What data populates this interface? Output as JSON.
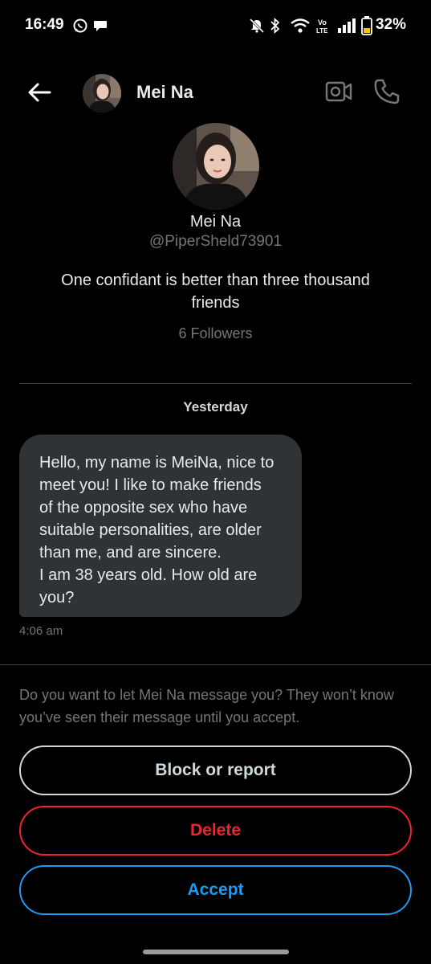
{
  "status_bar": {
    "time": "16:49",
    "battery": "32%",
    "icons": [
      "whatsapp-icon",
      "chat-bubble-icon",
      "silent-bell-icon",
      "bluetooth-icon",
      "wifi-icon",
      "volte-icon",
      "signal-icon",
      "battery-icon"
    ]
  },
  "header": {
    "name": "Mei Na",
    "icons": [
      "back-arrow-icon",
      "video-call-icon",
      "phone-icon"
    ]
  },
  "profile": {
    "name": "Mei Na",
    "handle": "@PiperSheld73901",
    "bio": "One confidant is better than three thousand friends",
    "followers": "6 Followers"
  },
  "conversation": {
    "day_label": "Yesterday",
    "messages": [
      {
        "lines": [
          "Hello, my name is MeiNa, nice to",
          "meet you! I like to make friends",
          "of the opposite sex who have",
          "suitable personalities, are older",
          "than me, and are sincere.",
          "I am 38 years old. How old are",
          "you?"
        ],
        "time": "4:06 am"
      }
    ]
  },
  "request": {
    "prompt": "Do you want to let Mei Na message you? They won’t know you’ve seen their message until you accept.",
    "block_label": "Block or report",
    "delete_label": "Delete",
    "accept_label": "Accept"
  },
  "colors": {
    "background": "#000000",
    "bubble": "#2f3336",
    "muted": "#71767b",
    "danger": "#f4212e",
    "accent": "#1d9bf0"
  }
}
